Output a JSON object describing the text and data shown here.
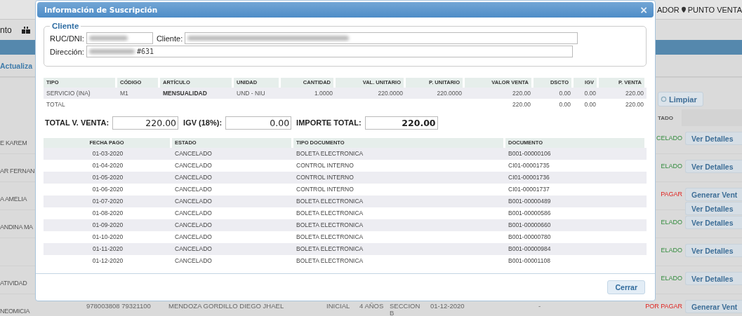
{
  "background": {
    "menu_label": "nto",
    "header_right": {
      "role": "ADOR",
      "location": "PUNTO VENTA"
    },
    "refresh_link": "Actualiza",
    "clear_button": "Limpiar",
    "status_header": "TADO",
    "rows": [
      {
        "name": "E KAREM",
        "status": "CELADO",
        "paid": true,
        "actions": [
          "Ver Detalles"
        ]
      },
      {
        "name": "AR FERNAN",
        "status": "ELADO",
        "paid": true,
        "actions": [
          "Ver Detalles"
        ]
      },
      {
        "name": "A AMELIA",
        "status": "PAGAR",
        "paid": false,
        "actions": [
          "Generar Vent",
          "Ver Detalles"
        ]
      },
      {
        "name": "ANDINA MA",
        "status": "ELADO",
        "paid": true,
        "actions": [
          "Ver Detalles"
        ]
      },
      {
        "status": "ELADO",
        "paid": true,
        "actions": [
          "Ver Detalles"
        ]
      },
      {
        "name": "ATIVIDAD",
        "status": "ELADO",
        "paid": true,
        "actions": [
          "Ver Detalles"
        ]
      },
      {
        "name": "NEOMICIA",
        "status": "POR PAGAR",
        "paid": false,
        "actions": [
          "Generar Vent"
        ],
        "details": [
          "978003808 79321100",
          "MENDOZA GORDILLO DIEGO JHAEL",
          "INICIAL",
          "4 AÑOS",
          "SECCION B",
          "01-12-2020",
          "-"
        ]
      }
    ]
  },
  "dialog": {
    "title": "Información de Suscripción",
    "close_glyph": "×",
    "client": {
      "legend": "Cliente",
      "id_label": "RUC/DNI:",
      "id_redacted": true,
      "client_label": "Cliente:",
      "client_redacted": true,
      "address_label": "Dirección:",
      "address_redacted": true,
      "address_value": "#631"
    },
    "items": {
      "columns": [
        "TIPO",
        "CÓDIGO",
        "ARTÍCULO",
        "UNIDAD",
        "CANTIDAD",
        "VAL. UNITARIO",
        "P. UNITARIO",
        "VALOR VENTA",
        "DSCTO",
        "IGV",
        "P. VENTA"
      ],
      "rows": [
        [
          "SERVICIO (INA)",
          "M1",
          "MENSUALIDAD",
          "UND - NIU",
          "1.0000",
          "220.0000",
          "220.0000",
          "220.00",
          "0.00",
          "0.00",
          "220.00"
        ]
      ],
      "total": {
        "label": "TOTAL",
        "values": [
          "220.00",
          "0.00",
          "0.00",
          "220.00"
        ]
      }
    },
    "totals": [
      {
        "label": "TOTAL V. VENTA:",
        "value": "220.00",
        "emphasized": false
      },
      {
        "label": "IGV (18%):",
        "value": "0.00",
        "emphasized": false
      },
      {
        "label": "IMPORTE TOTAL:",
        "value": "220.00",
        "emphasized": true
      }
    ],
    "payments": {
      "columns": [
        "FECHA PAGO",
        "ESTADO",
        "TIPO DOCUMENTO",
        "DOCUMENTO"
      ],
      "rows": [
        [
          "01-03-2020",
          "CANCELADO",
          "BOLETA ELECTRONICA",
          "B001-00000106"
        ],
        [
          "01-04-2020",
          "CANCELADO",
          "CONTROL INTERNO",
          "CI01-00001735"
        ],
        [
          "01-05-2020",
          "CANCELADO",
          "CONTROL INTERNO",
          "CI01-00001736"
        ],
        [
          "01-06-2020",
          "CANCELADO",
          "CONTROL INTERNO",
          "CI01-00001737"
        ],
        [
          "01-07-2020",
          "CANCELADO",
          "BOLETA ELECTRONICA",
          "B001-00000489"
        ],
        [
          "01-08-2020",
          "CANCELADO",
          "BOLETA ELECTRONICA",
          "B001-00000586"
        ],
        [
          "01-09-2020",
          "CANCELADO",
          "BOLETA ELECTRONICA",
          "B001-00000660"
        ],
        [
          "01-10-2020",
          "CANCELADO",
          "BOLETA ELECTRONICA",
          "B001-00000780"
        ],
        [
          "01-11-2020",
          "CANCELADO",
          "BOLETA ELECTRONICA",
          "B001-00000984"
        ],
        [
          "01-12-2020",
          "CANCELADO",
          "BOLETA ELECTRONICA",
          "B001-00001108"
        ]
      ]
    },
    "close_button": "Cerrar"
  }
}
